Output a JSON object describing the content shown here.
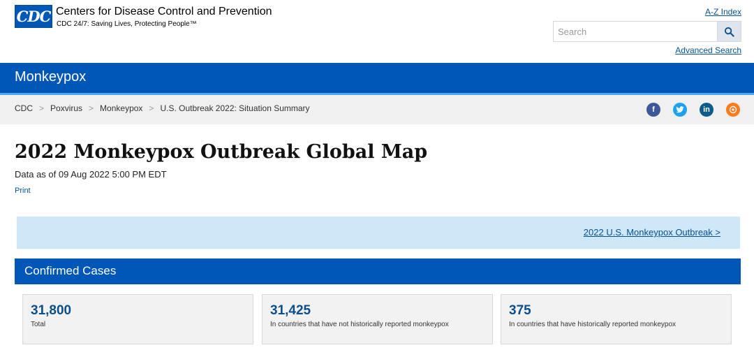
{
  "header": {
    "logo_text": "CDC",
    "org_name": "Centers for Disease Control and Prevention",
    "tagline": "CDC 24/7: Saving Lives, Protecting People™",
    "az_index_label": "A-Z Index",
    "search_placeholder": "Search",
    "advanced_search_label": "Advanced Search"
  },
  "banner": {
    "title": "Monkeypox"
  },
  "breadcrumb": {
    "items": [
      "CDC",
      "Poxvirus",
      "Monkeypox",
      "U.S. Outbreak 2022: Situation Summary"
    ],
    "separator": ">"
  },
  "social": {
    "icons": [
      "facebook-icon",
      "twitter-icon",
      "linkedin-icon",
      "syndicate-icon"
    ]
  },
  "main": {
    "title": "2022 Monkeypox Outbreak Global Map",
    "data_as_of": "Data as of 09 Aug 2022 5:00 PM EDT",
    "print_label": "Print",
    "callout_link": "2022 U.S. Monkeypox Outbreak >",
    "section_title": "Confirmed Cases",
    "stats": [
      {
        "value": "31,800",
        "label": "Total"
      },
      {
        "value": "31,425",
        "label": "In countries that have not historically reported monkeypox"
      },
      {
        "value": "375",
        "label": "In countries that have historically reported monkeypox"
      }
    ]
  },
  "colors": {
    "brand_blue": "#0057b7",
    "link_blue": "#075290",
    "callout_bg": "#cfe8f8"
  }
}
